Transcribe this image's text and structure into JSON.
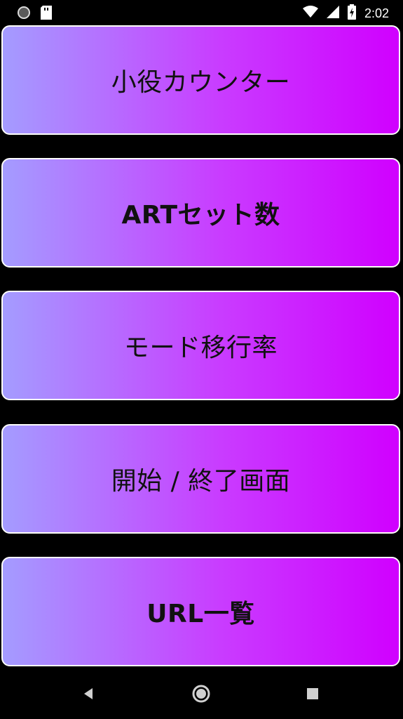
{
  "status_bar": {
    "time": "2:02",
    "icons": [
      "record-icon",
      "sd-card-icon",
      "wifi-icon",
      "cell-signal-icon",
      "battery-charging-icon"
    ]
  },
  "menu": {
    "items": [
      {
        "label": "小役カウンター"
      },
      {
        "label": "ARTセット数"
      },
      {
        "label": "モード移行率"
      },
      {
        "label": "開始 / 終了画面"
      },
      {
        "label": "URL一覧"
      }
    ]
  },
  "nav_bar": {
    "icons": [
      "back-icon",
      "home-icon",
      "recents-icon"
    ]
  },
  "colors": {
    "gradient_start": "#a49cff",
    "gradient_end": "#d000ff",
    "button_border": "#ffffff",
    "background": "#000000",
    "label": "#111111"
  }
}
